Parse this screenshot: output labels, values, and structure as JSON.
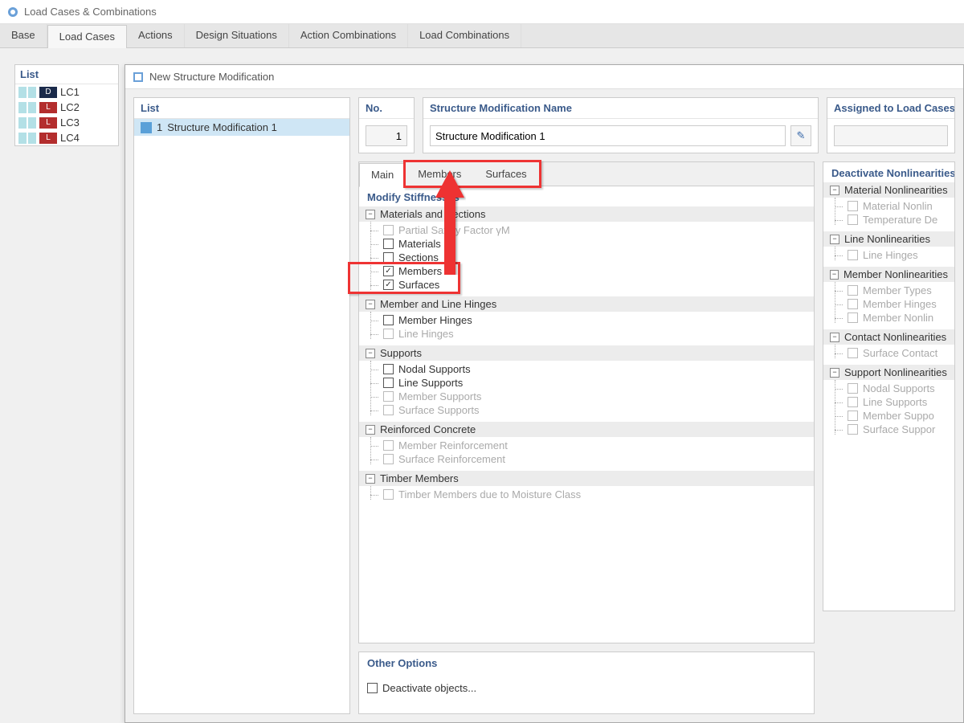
{
  "window": {
    "title": "Load Cases & Combinations"
  },
  "mainTabs": [
    "Base",
    "Load Cases",
    "Actions",
    "Design Situations",
    "Action Combinations",
    "Load Combinations"
  ],
  "activeMainTab": 1,
  "leftList": {
    "header": "List",
    "rows": [
      {
        "badge": "D",
        "badgeDark": true,
        "name": "LC1"
      },
      {
        "badge": "L",
        "badgeDark": false,
        "name": "LC2"
      },
      {
        "badge": "L",
        "badgeDark": false,
        "name": "LC3"
      },
      {
        "badge": "L",
        "badgeDark": false,
        "name": "LC4"
      }
    ]
  },
  "dialog": {
    "title": "New Structure Modification",
    "list": {
      "header": "List",
      "rowIndex": "1",
      "rowText": "Structure Modification 1"
    },
    "noLabel": "No.",
    "noValue": "1",
    "nameLabel": "Structure Modification Name",
    "nameValue": "Structure Modification 1",
    "assignedLabel": "Assigned to Load Cases / C",
    "subTabs": [
      "Main",
      "Members",
      "Surfaces"
    ],
    "activeSubTab": 0,
    "modifyHeader": "Modify Stiffnesses",
    "groups": [
      {
        "name": "Materials and Sections",
        "items": [
          {
            "label": "Partial Safety Factor γM",
            "dim": true,
            "checked": false
          },
          {
            "label": "Materials",
            "dim": false,
            "checked": false
          },
          {
            "label": "Sections",
            "dim": false,
            "checked": false
          },
          {
            "label": "Members",
            "dim": false,
            "checked": true
          },
          {
            "label": "Surfaces",
            "dim": false,
            "checked": true
          }
        ]
      },
      {
        "name": "Member and Line Hinges",
        "items": [
          {
            "label": "Member Hinges",
            "dim": false,
            "checked": false
          },
          {
            "label": "Line Hinges",
            "dim": true,
            "checked": false
          }
        ]
      },
      {
        "name": "Supports",
        "items": [
          {
            "label": "Nodal Supports",
            "dim": false,
            "checked": false
          },
          {
            "label": "Line Supports",
            "dim": false,
            "checked": false
          },
          {
            "label": "Member Supports",
            "dim": true,
            "checked": false
          },
          {
            "label": "Surface Supports",
            "dim": true,
            "checked": false
          }
        ]
      },
      {
        "name": "Reinforced Concrete",
        "items": [
          {
            "label": "Member Reinforcement",
            "dim": true,
            "checked": false
          },
          {
            "label": "Surface Reinforcement",
            "dim": true,
            "checked": false
          }
        ]
      },
      {
        "name": "Timber Members",
        "items": [
          {
            "label": "Timber Members due to Moisture Class",
            "dim": true,
            "checked": false
          }
        ]
      }
    ],
    "otherHeader": "Other Options",
    "deactivateObjects": "Deactivate objects...",
    "deactTitle": "Deactivate Nonlinearities",
    "deactGroups": [
      {
        "name": "Material Nonlinearities",
        "items": [
          "Material Nonlin",
          "Temperature De"
        ]
      },
      {
        "name": "Line Nonlinearities",
        "items": [
          "Line Hinges"
        ]
      },
      {
        "name": "Member Nonlinearities",
        "items": [
          "Member Types",
          "Member Hinges",
          "Member Nonlin"
        ]
      },
      {
        "name": "Contact Nonlinearities",
        "items": [
          "Surface Contact"
        ]
      },
      {
        "name": "Support Nonlinearities",
        "items": [
          "Nodal Supports",
          "Line Supports",
          "Member Suppo",
          "Surface Suppor"
        ]
      }
    ]
  }
}
